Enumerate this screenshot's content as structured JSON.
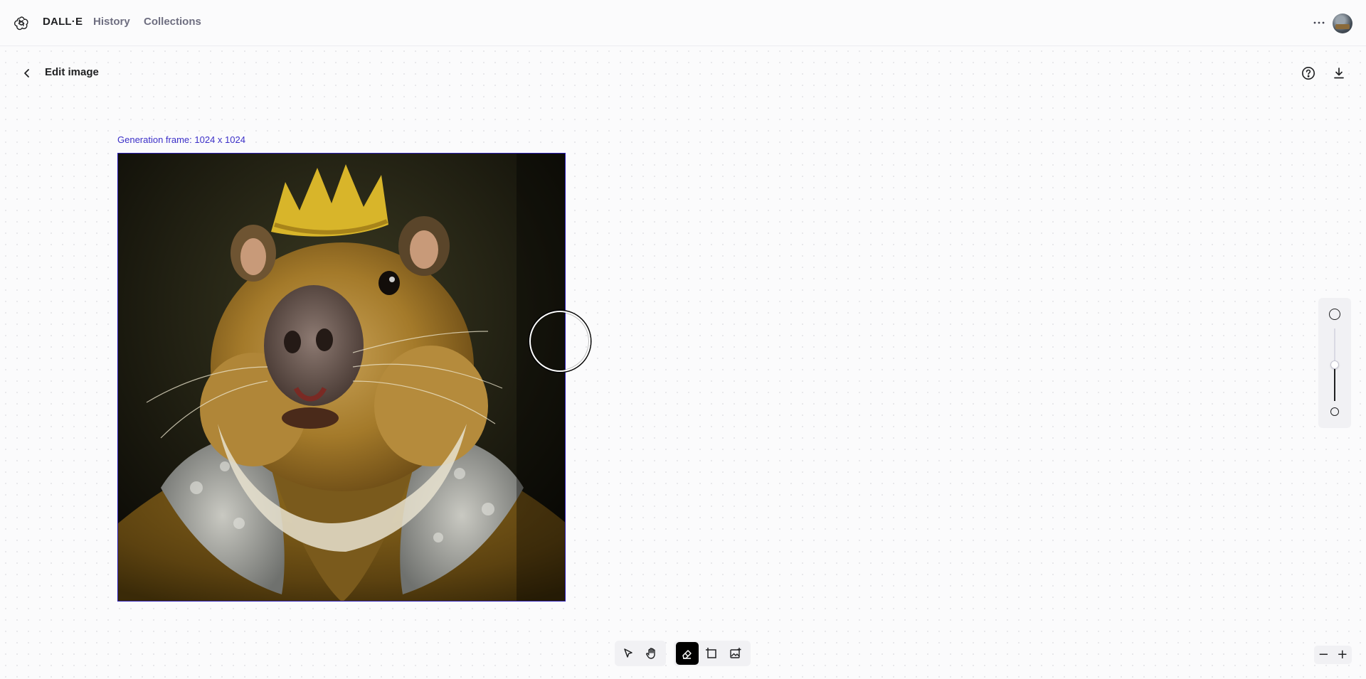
{
  "header": {
    "brand": "DALL·E",
    "nav": [
      {
        "label": "History"
      },
      {
        "label": "Collections"
      }
    ],
    "more_icon": "ellipsis-icon",
    "avatar_icon": "user-avatar"
  },
  "editor": {
    "title": "Edit image",
    "back_icon": "chevron-left-icon",
    "help_icon": "question-circle-icon",
    "download_icon": "download-icon",
    "frame_label": "Generation frame: 1024 x 1024",
    "image_alt": "Oil painting of a capybara wearing a golden crown and fur-trimmed royal robe"
  },
  "brush_size": {
    "level": 0.5,
    "large_icon": "large-circle-icon",
    "small_icon": "small-circle-icon"
  },
  "toolbar": {
    "tools": [
      {
        "name": "select",
        "icon": "cursor-arrow-icon",
        "active": false
      },
      {
        "name": "pan",
        "icon": "hand-icon",
        "active": false
      },
      {
        "name": "eraser",
        "icon": "eraser-icon",
        "active": true
      },
      {
        "name": "add-generation-frame",
        "icon": "frame-icon",
        "active": false
      },
      {
        "name": "upload-image",
        "icon": "image-plus-icon",
        "active": false
      }
    ]
  },
  "zoom": {
    "out_label": "−",
    "in_label": "+"
  },
  "colors": {
    "frame_border": "#2a1bb3",
    "frame_label": "#3b2fc8",
    "active_tool": "#000000"
  }
}
